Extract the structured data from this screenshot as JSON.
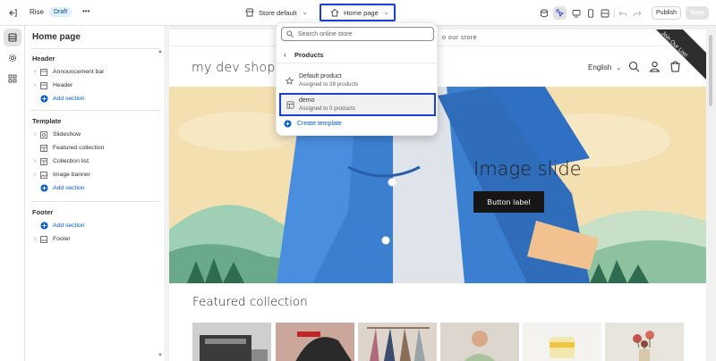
{
  "topbar": {
    "theme_name": "Rise",
    "status_badge": "Draft",
    "more_label": "•••",
    "store_selector": "Store default",
    "page_selector": "Home page",
    "publish_label": "Publish",
    "save_label": "Save"
  },
  "sidebar": {
    "title": "Home page",
    "header_group": {
      "label": "Header",
      "items": [
        {
          "label": "Announcement bar",
          "icon": "section-icon"
        },
        {
          "label": "Header",
          "icon": "section-icon"
        }
      ],
      "add_label": "Add section"
    },
    "template_group": {
      "label": "Template",
      "items": [
        {
          "label": "Slideshow",
          "icon": "slideshow-icon"
        },
        {
          "label": "Featured collection",
          "icon": "section-icon"
        },
        {
          "label": "Collection list",
          "icon": "section-icon"
        },
        {
          "label": "Image banner",
          "icon": "image-icon"
        }
      ],
      "add_label": "Add section"
    },
    "footer_group": {
      "label": "Footer",
      "add_label": "Add section",
      "items": [
        {
          "label": "Footer",
          "icon": "section-icon"
        }
      ]
    }
  },
  "dropdown": {
    "search_placeholder": "Search online store",
    "back_label": "Products",
    "items": [
      {
        "title": "Default product",
        "subtitle": "Assigned to 28 products",
        "icon": "star-icon"
      },
      {
        "title": "demo",
        "subtitle": "Assigned to 0 products",
        "icon": "template-icon"
      }
    ],
    "create_label": "Create template"
  },
  "store_preview": {
    "announcement": "o our store",
    "shop_name": "my dev shop",
    "language": "English",
    "ribbon": "Join Our List!",
    "slide_heading": "Image slide",
    "slide_button": "Button label",
    "featured_heading": "Featured collection"
  },
  "colors": {
    "accent_blue": "#005bd3",
    "highlight_outline": "#1a3fd6",
    "sky": "#f3dfb0",
    "jacket": "#3b7fd1",
    "hill_green": "#9fcfb4"
  }
}
